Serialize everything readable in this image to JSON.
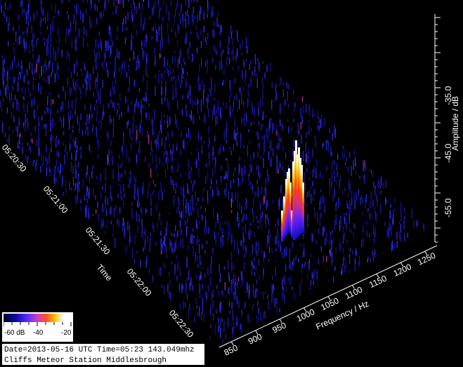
{
  "chart_data": {
    "type": "waterfall",
    "xlabel": "Frequency / Hz",
    "ylabel": "Time",
    "zlabel": "Amplitude / dB",
    "x_ticks": [
      "850",
      "900",
      "950",
      "1000",
      "1050",
      "1100",
      "1150",
      "1200",
      "1250"
    ],
    "time_ticks": [
      "05:20:30",
      "05:21:00",
      "05:21:30",
      "05:22:00",
      "05:22:30"
    ],
    "z_ticks": [
      "-35.0",
      "-45.0",
      "-55.0"
    ],
    "noise_floor_db": -60,
    "peak": {
      "frequency_hz": 1000,
      "time": "05:21:45",
      "amplitude_db": -43
    },
    "colors": {
      "background": "#000000",
      "noise": "#2020c0",
      "peak_core": "#ffffff"
    }
  },
  "legend": {
    "labels": [
      "-60 dB",
      "-40",
      "-20"
    ]
  },
  "info": {
    "line1": "Date=2013-05-16 UTC Time=05:23 143.049mhz",
    "line2": "Cliffs Meteor Station Middlesbrough"
  }
}
